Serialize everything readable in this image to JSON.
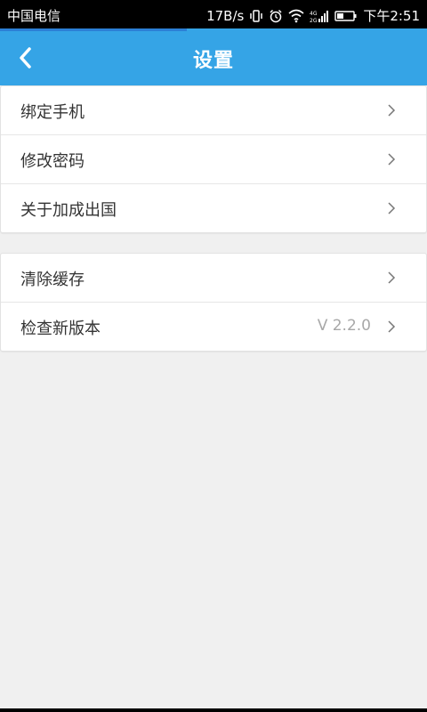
{
  "status_bar": {
    "carrier": "中国电信",
    "speed": "17B/s",
    "time": "下午2:51",
    "icons": [
      "vibrate-icon",
      "alarm-icon",
      "wifi-icon",
      "signal-icon",
      "battery-icon"
    ]
  },
  "app_bar": {
    "title": "设置",
    "back_icon": "chevron-left-icon"
  },
  "groups": [
    {
      "items": [
        {
          "label": "绑定手机"
        },
        {
          "label": "修改密码"
        },
        {
          "label": "关于加成出国"
        }
      ]
    },
    {
      "items": [
        {
          "label": "清除缓存"
        },
        {
          "label": "检查新版本",
          "value": "V 2.2.0"
        }
      ]
    }
  ],
  "colors": {
    "app_bar": "#35a4e6",
    "background": "#f0f0f0",
    "value_text": "#a8a8a8"
  }
}
